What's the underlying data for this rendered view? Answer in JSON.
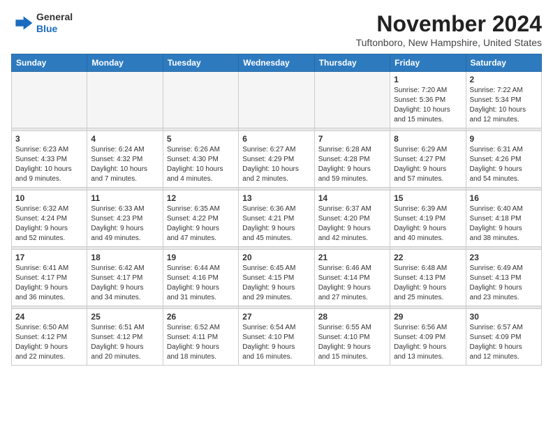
{
  "header": {
    "logo_line1": "General",
    "logo_line2": "Blue",
    "month": "November 2024",
    "location": "Tuftonboro, New Hampshire, United States"
  },
  "weekdays": [
    "Sunday",
    "Monday",
    "Tuesday",
    "Wednesday",
    "Thursday",
    "Friday",
    "Saturday"
  ],
  "weeks": [
    [
      {
        "day": "",
        "info": ""
      },
      {
        "day": "",
        "info": ""
      },
      {
        "day": "",
        "info": ""
      },
      {
        "day": "",
        "info": ""
      },
      {
        "day": "",
        "info": ""
      },
      {
        "day": "1",
        "info": "Sunrise: 7:20 AM\nSunset: 5:36 PM\nDaylight: 10 hours\nand 15 minutes."
      },
      {
        "day": "2",
        "info": "Sunrise: 7:22 AM\nSunset: 5:34 PM\nDaylight: 10 hours\nand 12 minutes."
      }
    ],
    [
      {
        "day": "3",
        "info": "Sunrise: 6:23 AM\nSunset: 4:33 PM\nDaylight: 10 hours\nand 9 minutes."
      },
      {
        "day": "4",
        "info": "Sunrise: 6:24 AM\nSunset: 4:32 PM\nDaylight: 10 hours\nand 7 minutes."
      },
      {
        "day": "5",
        "info": "Sunrise: 6:26 AM\nSunset: 4:30 PM\nDaylight: 10 hours\nand 4 minutes."
      },
      {
        "day": "6",
        "info": "Sunrise: 6:27 AM\nSunset: 4:29 PM\nDaylight: 10 hours\nand 2 minutes."
      },
      {
        "day": "7",
        "info": "Sunrise: 6:28 AM\nSunset: 4:28 PM\nDaylight: 9 hours\nand 59 minutes."
      },
      {
        "day": "8",
        "info": "Sunrise: 6:29 AM\nSunset: 4:27 PM\nDaylight: 9 hours\nand 57 minutes."
      },
      {
        "day": "9",
        "info": "Sunrise: 6:31 AM\nSunset: 4:26 PM\nDaylight: 9 hours\nand 54 minutes."
      }
    ],
    [
      {
        "day": "10",
        "info": "Sunrise: 6:32 AM\nSunset: 4:24 PM\nDaylight: 9 hours\nand 52 minutes."
      },
      {
        "day": "11",
        "info": "Sunrise: 6:33 AM\nSunset: 4:23 PM\nDaylight: 9 hours\nand 49 minutes."
      },
      {
        "day": "12",
        "info": "Sunrise: 6:35 AM\nSunset: 4:22 PM\nDaylight: 9 hours\nand 47 minutes."
      },
      {
        "day": "13",
        "info": "Sunrise: 6:36 AM\nSunset: 4:21 PM\nDaylight: 9 hours\nand 45 minutes."
      },
      {
        "day": "14",
        "info": "Sunrise: 6:37 AM\nSunset: 4:20 PM\nDaylight: 9 hours\nand 42 minutes."
      },
      {
        "day": "15",
        "info": "Sunrise: 6:39 AM\nSunset: 4:19 PM\nDaylight: 9 hours\nand 40 minutes."
      },
      {
        "day": "16",
        "info": "Sunrise: 6:40 AM\nSunset: 4:18 PM\nDaylight: 9 hours\nand 38 minutes."
      }
    ],
    [
      {
        "day": "17",
        "info": "Sunrise: 6:41 AM\nSunset: 4:17 PM\nDaylight: 9 hours\nand 36 minutes."
      },
      {
        "day": "18",
        "info": "Sunrise: 6:42 AM\nSunset: 4:17 PM\nDaylight: 9 hours\nand 34 minutes."
      },
      {
        "day": "19",
        "info": "Sunrise: 6:44 AM\nSunset: 4:16 PM\nDaylight: 9 hours\nand 31 minutes."
      },
      {
        "day": "20",
        "info": "Sunrise: 6:45 AM\nSunset: 4:15 PM\nDaylight: 9 hours\nand 29 minutes."
      },
      {
        "day": "21",
        "info": "Sunrise: 6:46 AM\nSunset: 4:14 PM\nDaylight: 9 hours\nand 27 minutes."
      },
      {
        "day": "22",
        "info": "Sunrise: 6:48 AM\nSunset: 4:13 PM\nDaylight: 9 hours\nand 25 minutes."
      },
      {
        "day": "23",
        "info": "Sunrise: 6:49 AM\nSunset: 4:13 PM\nDaylight: 9 hours\nand 23 minutes."
      }
    ],
    [
      {
        "day": "24",
        "info": "Sunrise: 6:50 AM\nSunset: 4:12 PM\nDaylight: 9 hours\nand 22 minutes."
      },
      {
        "day": "25",
        "info": "Sunrise: 6:51 AM\nSunset: 4:12 PM\nDaylight: 9 hours\nand 20 minutes."
      },
      {
        "day": "26",
        "info": "Sunrise: 6:52 AM\nSunset: 4:11 PM\nDaylight: 9 hours\nand 18 minutes."
      },
      {
        "day": "27",
        "info": "Sunrise: 6:54 AM\nSunset: 4:10 PM\nDaylight: 9 hours\nand 16 minutes."
      },
      {
        "day": "28",
        "info": "Sunrise: 6:55 AM\nSunset: 4:10 PM\nDaylight: 9 hours\nand 15 minutes."
      },
      {
        "day": "29",
        "info": "Sunrise: 6:56 AM\nSunset: 4:09 PM\nDaylight: 9 hours\nand 13 minutes."
      },
      {
        "day": "30",
        "info": "Sunrise: 6:57 AM\nSunset: 4:09 PM\nDaylight: 9 hours\nand 12 minutes."
      }
    ]
  ]
}
